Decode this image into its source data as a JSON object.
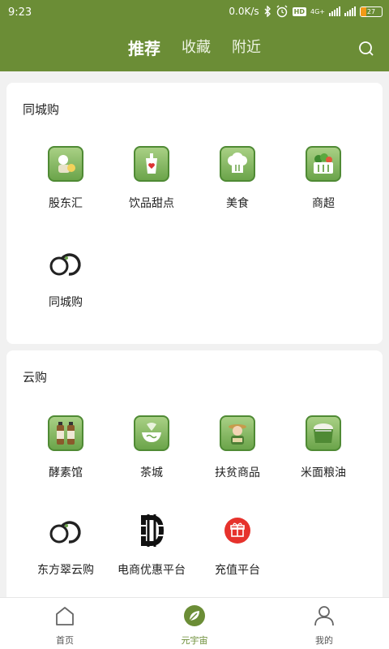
{
  "status_bar": {
    "time": "9:23",
    "speed": "0.0K/s",
    "hd": "HD",
    "net": "4G+",
    "battery": "27"
  },
  "header": {
    "tabs": [
      {
        "label": "推荐"
      },
      {
        "label": "收藏"
      },
      {
        "label": "附近"
      }
    ]
  },
  "sections": [
    {
      "title": "同城购",
      "items": [
        {
          "label": "股东汇"
        },
        {
          "label": "饮品甜点"
        },
        {
          "label": "美食"
        },
        {
          "label": "商超"
        },
        {
          "label": "同城购"
        }
      ]
    },
    {
      "title": "云购",
      "items": [
        {
          "label": "酵素馆"
        },
        {
          "label": "茶城"
        },
        {
          "label": "扶贫商品"
        },
        {
          "label": "米面粮油"
        },
        {
          "label": "东方翠云购"
        },
        {
          "label": "电商优惠平台"
        },
        {
          "label": "充值平台"
        }
      ]
    }
  ],
  "bottom_nav": [
    {
      "label": "首页"
    },
    {
      "label": "元宇宙"
    },
    {
      "label": "我的"
    }
  ],
  "colors": {
    "brand": "#6b8d36",
    "icon_green": "#6ba44a",
    "recharge_red": "#e6322c"
  }
}
